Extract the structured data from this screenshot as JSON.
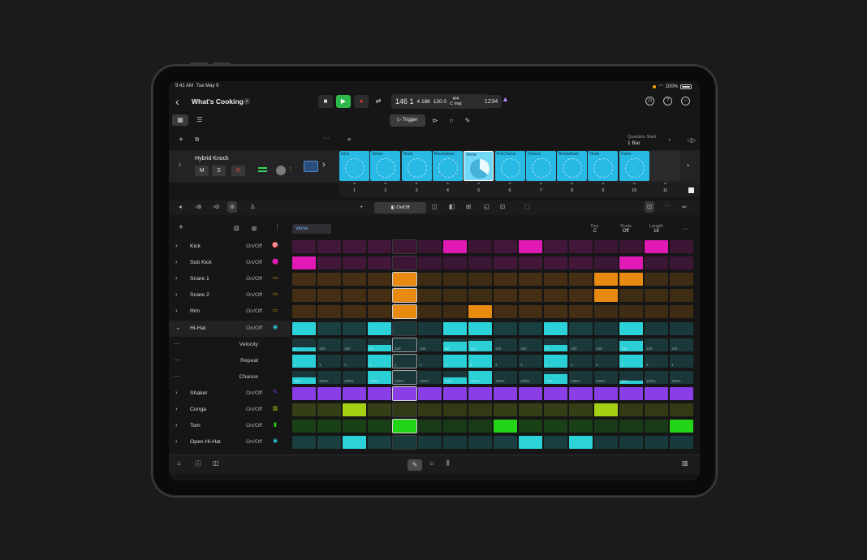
{
  "status": {
    "time": "9:41 AM",
    "date": "Tue May 9",
    "battery": "100%"
  },
  "control_bar": {
    "project_title": "What's Cooking",
    "position": "146 1",
    "bars": "4 186",
    "tempo": "120.0",
    "time_signature": "4/4",
    "key": "C maj",
    "count_in": "1234"
  },
  "toolbar": {
    "trigger_label": "Trigger"
  },
  "scene_header": {
    "quantize_label": "Quantize Start",
    "quantize_value": "1 Bar"
  },
  "track": {
    "number": "1",
    "name": "Hybrid Knock",
    "mute": "M",
    "solo": "S",
    "record": "R",
    "cells": [
      "Intro",
      "Verse",
      "Hook",
      "Breakdown",
      "Verse",
      "PreChorus",
      "Chorus",
      "Breakdown",
      "Hook",
      "Outro"
    ],
    "scenes": [
      "1",
      "2",
      "3",
      "4",
      "5",
      "6",
      "7",
      "8",
      "9",
      "10",
      "11"
    ]
  },
  "seq_toolbar": {
    "onoff_label": "On/Off"
  },
  "pattern": {
    "name": "Verse",
    "key_label": "Key",
    "key_value": "C",
    "scale_label": "Scale",
    "scale_value": "Off",
    "length_label": "Length",
    "length_value": "16"
  },
  "rows": [
    {
      "name": "Kick",
      "value": "On/Off",
      "color": "#e11ab5",
      "steps": [
        0,
        0,
        0,
        0,
        0,
        0,
        1,
        0,
        0,
        1,
        0,
        0,
        0,
        0,
        1,
        0
      ]
    },
    {
      "name": "Sub Kick",
      "value": "On/Off",
      "color": "#e11ab5",
      "steps": [
        1,
        0,
        0,
        0,
        0,
        0,
        0,
        0,
        0,
        0,
        0,
        0,
        0,
        1,
        0,
        0
      ]
    },
    {
      "name": "Snare 1",
      "value": "On/Off",
      "color": "#e88a10",
      "steps": [
        0,
        0,
        0,
        0,
        1,
        0,
        0,
        0,
        0,
        0,
        0,
        0,
        1,
        1,
        0,
        0
      ]
    },
    {
      "name": "Snare 2",
      "value": "On/Off",
      "color": "#e88a10",
      "steps": [
        0,
        0,
        0,
        0,
        1,
        0,
        0,
        0,
        0,
        0,
        0,
        0,
        1,
        0,
        0,
        0
      ]
    },
    {
      "name": "Rim",
      "value": "On/Off",
      "color": "#e88a10",
      "steps": [
        0,
        0,
        0,
        0,
        1,
        0,
        0,
        1,
        0,
        0,
        0,
        0,
        0,
        0,
        0,
        0
      ]
    },
    {
      "name": "Hi-Hat",
      "value": "On/Off",
      "color": "#2bd3d8",
      "steps": [
        1,
        0,
        0,
        1,
        0,
        0,
        1,
        1,
        0,
        0,
        1,
        0,
        0,
        1,
        0,
        0
      ]
    },
    {
      "name": "Shaker",
      "value": "On/Off",
      "color": "#8a3ee6",
      "steps": [
        1,
        1,
        1,
        1,
        1,
        1,
        1,
        1,
        1,
        1,
        1,
        1,
        1,
        1,
        1,
        1
      ]
    },
    {
      "name": "Conga",
      "value": "On/Off",
      "color": "#a4d012",
      "steps": [
        0,
        0,
        1,
        0,
        0,
        0,
        0,
        0,
        0,
        0,
        0,
        0,
        1,
        0,
        0,
        0
      ]
    },
    {
      "name": "Tom",
      "value": "On/Off",
      "color": "#23d418",
      "steps": [
        0,
        0,
        0,
        0,
        1,
        0,
        0,
        0,
        1,
        0,
        0,
        0,
        0,
        0,
        0,
        1
      ]
    },
    {
      "name": "Open Hi-Hat",
      "value": "On/Off",
      "color": "#2bd3d8",
      "steps": [
        0,
        0,
        1,
        0,
        0,
        0,
        0,
        0,
        0,
        1,
        0,
        1,
        0,
        0,
        0,
        0
      ]
    }
  ],
  "subrows": [
    {
      "name": "Velocity",
      "labels": [
        "0",
        "100",
        "100",
        "62",
        "100",
        "100",
        "88",
        "102",
        "100",
        "100",
        "67",
        "100",
        "100",
        "100",
        "100",
        "100"
      ],
      "levels": [
        0.3,
        0,
        0,
        0.5,
        0,
        0,
        0.7,
        0.8,
        0,
        0,
        0.5,
        0,
        0,
        0.8,
        0,
        0
      ]
    },
    {
      "name": "Repeat",
      "labels": [
        "1",
        "1",
        "1",
        "1",
        "1",
        "1",
        "3",
        "8",
        "4",
        "1",
        "1",
        "1",
        "1",
        "1",
        "1",
        "1"
      ],
      "levels": [
        1,
        0,
        0,
        1,
        0,
        0,
        1,
        1,
        0,
        0,
        1,
        0,
        0,
        1,
        0,
        0
      ]
    },
    {
      "name": "Chance",
      "labels": [
        "50%",
        "100%",
        "100%",
        "100%",
        "100%",
        "100%",
        "50%",
        "100%",
        "100%",
        "100%",
        "75%",
        "100%",
        "100%",
        "25%",
        "100%",
        "100%"
      ],
      "levels": [
        0.5,
        0,
        0,
        1,
        0,
        0,
        0.5,
        1,
        0,
        0,
        0.75,
        0,
        0,
        0.25,
        0,
        0
      ]
    }
  ]
}
